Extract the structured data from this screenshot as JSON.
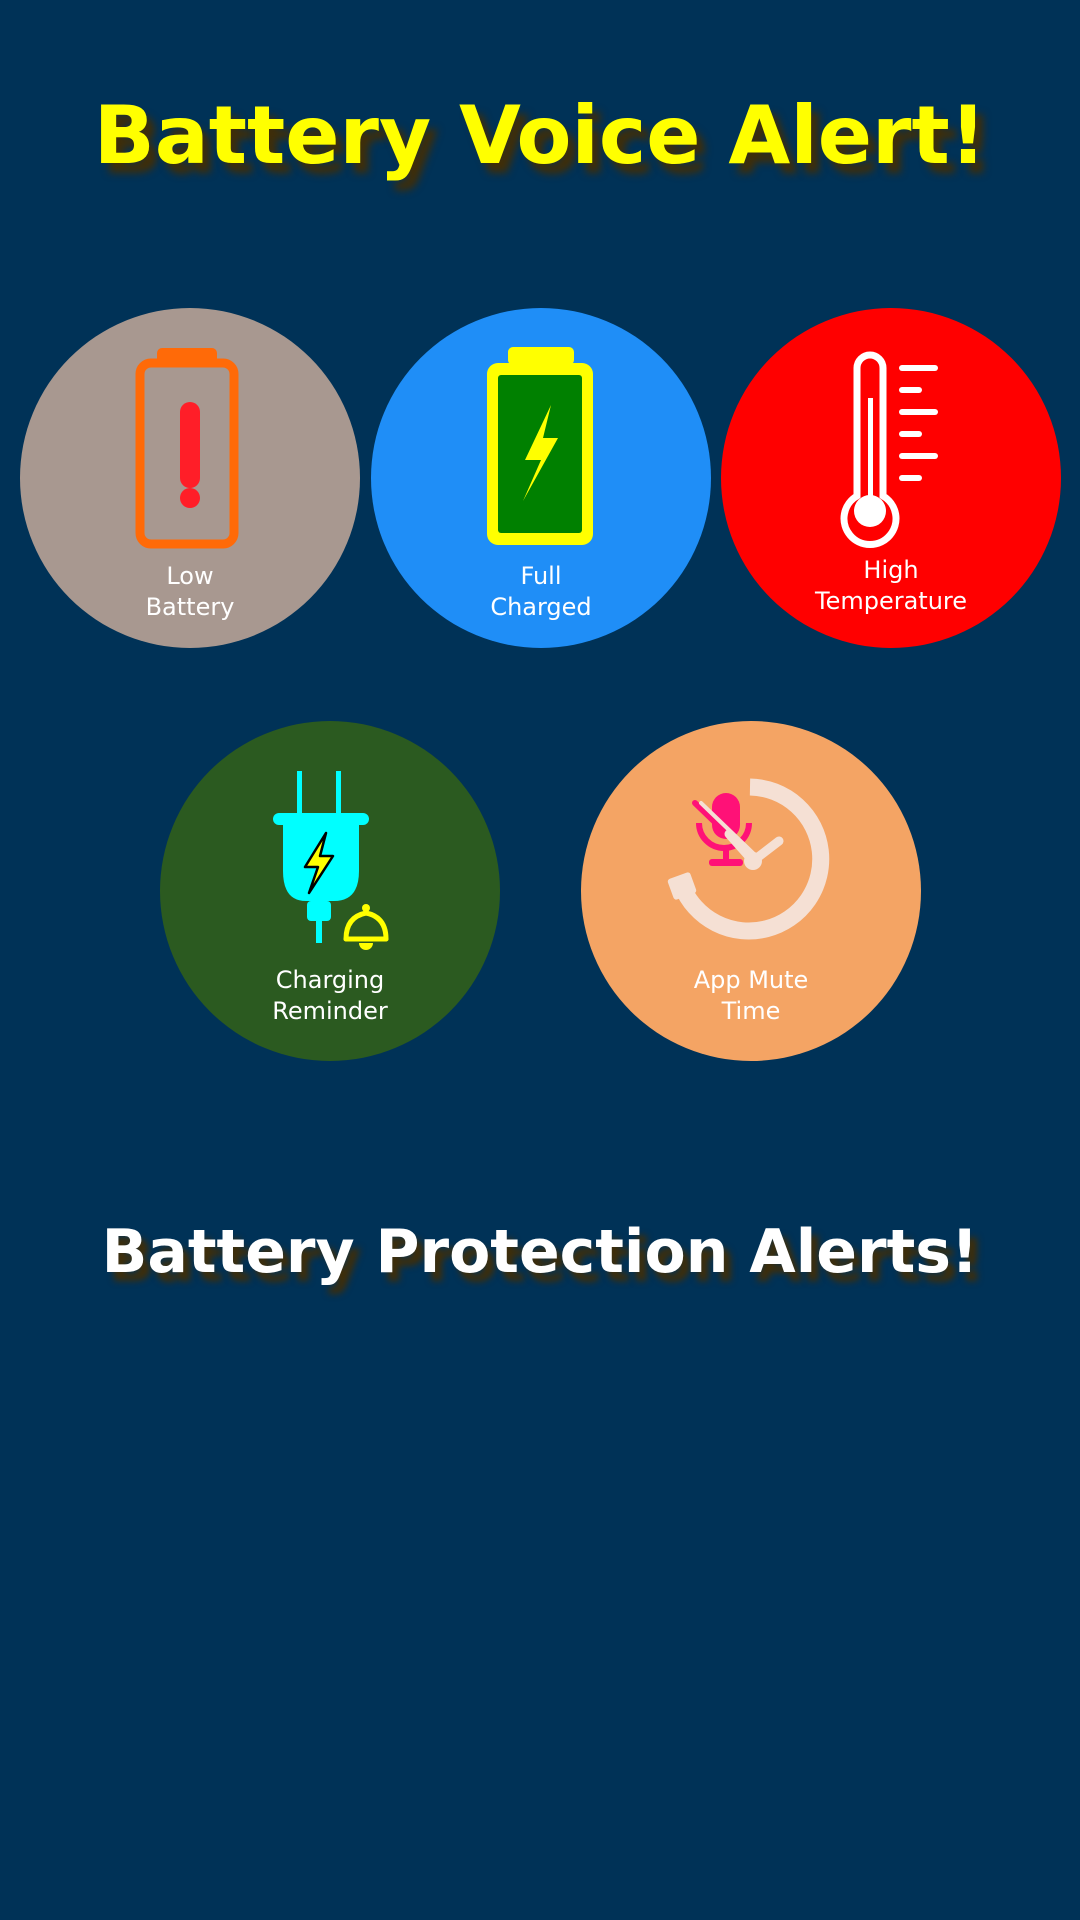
{
  "header": {
    "title": "Battery Voice Alert!"
  },
  "alerts": [
    {
      "id": "low",
      "line1": "Low",
      "line2": "Battery",
      "icon": "low-battery-icon",
      "color": "#a89890"
    },
    {
      "id": "full",
      "line1": "Full",
      "line2": "Charged",
      "icon": "full-battery-icon",
      "color": "#1f8ef7"
    },
    {
      "id": "temp",
      "line1": "High",
      "line2": "Temperature",
      "icon": "thermometer-icon",
      "color": "#ff0000"
    },
    {
      "id": "charge",
      "line1": "Charging",
      "line2": "Reminder",
      "icon": "plug-bell-icon",
      "color": "#2b5a20"
    },
    {
      "id": "mute",
      "line1": "App Mute",
      "line2": "Time",
      "icon": "mute-timer-icon",
      "color": "#f4a464"
    }
  ],
  "footer": {
    "title": "Battery Protection Alerts!"
  },
  "colors": {
    "background": "#003257",
    "title": "#ffff00",
    "subtitle": "#ffffff"
  }
}
